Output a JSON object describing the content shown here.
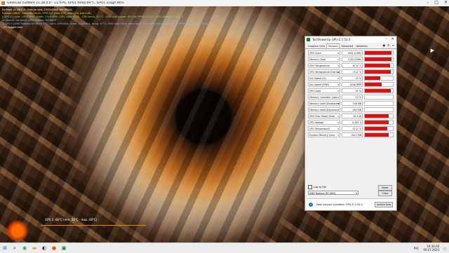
{
  "window": {
    "title": "Geeks3D FurMark v1.28.0.0 - 117FPS, GPU1 temp:69°C, GPU1 usage:96%"
  },
  "osd": {
    "line1": "FurMark v1.28.0.0 - Burn-in test, 1920x1080 (8X MSAA)",
    "line2": "Frames:29819 - time:00:04:13 - FPS:117 (min:117, max:123, avg:116)",
    "line3": "[ GPU-Z ] core: 1991 MHz - mem: 1740 MHz - GPU load: 92 % - GPU temp: 67 °C - GPU chip power: 95.0 W (PPW: 1.232) - GPU voltage: 0.981 V",
    "line4": "> OpenGL renderer: AMD Radeon RX 6600",
    "line5": "> GPU 1 (AMD Radeon RX 6600 XT) - core: 1991MHz, mem: 1740MHz, temp: 67°C, GPU load: 92%, mem load: 17%, GPU chip power: 95 W (PPW: 1.232), fan: 52%",
    "line6": "- F1: toggle help"
  },
  "graph": {
    "label": "GPU 1: 68°C (min: 34°C - max: 68°C)"
  },
  "gpuz": {
    "title": "TechPowerUp GPU-Z 2.53.0",
    "tabs": [
      "Graphics Card",
      "Sensors",
      "Advanced",
      "Validation"
    ],
    "active_tab": "Sensors",
    "sensors": [
      {
        "name": "GPU Clock",
        "value": "1991.0 MHz",
        "level": 0.95
      },
      {
        "name": "Memory Clock",
        "value": "1740.0 MHz",
        "level": 0.95
      },
      {
        "name": "GPU Temperature",
        "value": "67.0 °C",
        "level": 0.9
      },
      {
        "name": "GPU Temperature (Hot Spot)",
        "value": "75.0 °C",
        "level": 0.92
      },
      {
        "name": "Fan Speed (%)",
        "value": "55 %",
        "level": 0.55
      },
      {
        "name": "Fan Speed (RPM)",
        "value": "1946 RPM",
        "level": 0.6
      },
      {
        "name": "GPU Load",
        "value": "92 %",
        "level": 0.92
      },
      {
        "name": "Memory Controller Load",
        "value": "13 %",
        "level": 0.0
      },
      {
        "name": "Memory Used (Dedicated)",
        "value": "546 MB",
        "level": 0.0
      },
      {
        "name": "Memory Used (Dynamic)",
        "value": "164 MB",
        "level": 0.0
      },
      {
        "name": "GPU Chip Power Draw",
        "value": "95.0 W",
        "level": 0.85
      },
      {
        "name": "GPU Voltage",
        "value": "0.981 V",
        "level": 0.85
      },
      {
        "name": "CPU Temperature",
        "value": "57.0 °C",
        "level": 0.8
      },
      {
        "name": "System Memory Used",
        "value": "5412 MB",
        "level": 0.85
      }
    ],
    "log_label": "Log to file",
    "reset_label": "Reset",
    "gpu_select": "AMD Radeon RX 6600",
    "close_label": "Close",
    "notice": "New version available: GPU-Z 2.54.0",
    "update_label": "Update Now"
  },
  "taskbar": {
    "lang": "РУС",
    "time": "19:30:46",
    "date": "09.07.2023"
  },
  "colors": {
    "bar": "#d81212",
    "accent": "#1e6fd0"
  }
}
